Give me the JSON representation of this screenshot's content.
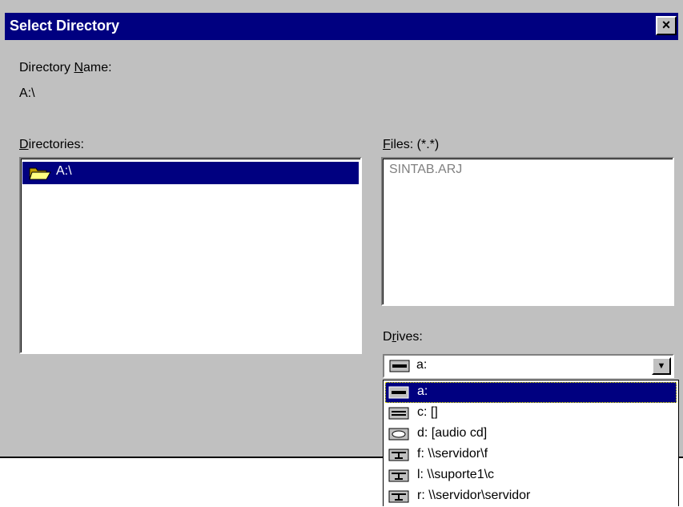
{
  "window": {
    "title": "Select Directory",
    "close_label": "×"
  },
  "directory_name": {
    "label_pre": "Directory ",
    "label_key": "N",
    "label_post": "ame:",
    "value": "A:\\"
  },
  "directories": {
    "label_key": "D",
    "label_post": "irectories:",
    "items": [
      {
        "label": "A:\\",
        "icon": "open-folder-icon",
        "selected": true
      }
    ]
  },
  "files": {
    "label_key": "F",
    "label_post": "iles: (*.*)",
    "items": [
      "SINTAB.ARJ"
    ]
  },
  "drives": {
    "label_pre": "D",
    "label_key": "r",
    "label_post": "ives:",
    "selected": "a:",
    "options": [
      {
        "label": "a:",
        "icon": "floppy-drive-icon"
      },
      {
        "label": "c: []",
        "icon": "hard-drive-icon"
      },
      {
        "label": "d: [audio cd]",
        "icon": "cd-drive-icon"
      },
      {
        "label": "f: \\\\servidor\\f",
        "icon": "network-drive-icon"
      },
      {
        "label": "l: \\\\suporte1\\c",
        "icon": "network-drive-icon"
      },
      {
        "label": "r: \\\\servidor\\servidor",
        "icon": "network-drive-icon"
      }
    ]
  },
  "colors": {
    "titlebar": "#000080",
    "face": "#c0c0c0",
    "highlight": "#000080"
  }
}
